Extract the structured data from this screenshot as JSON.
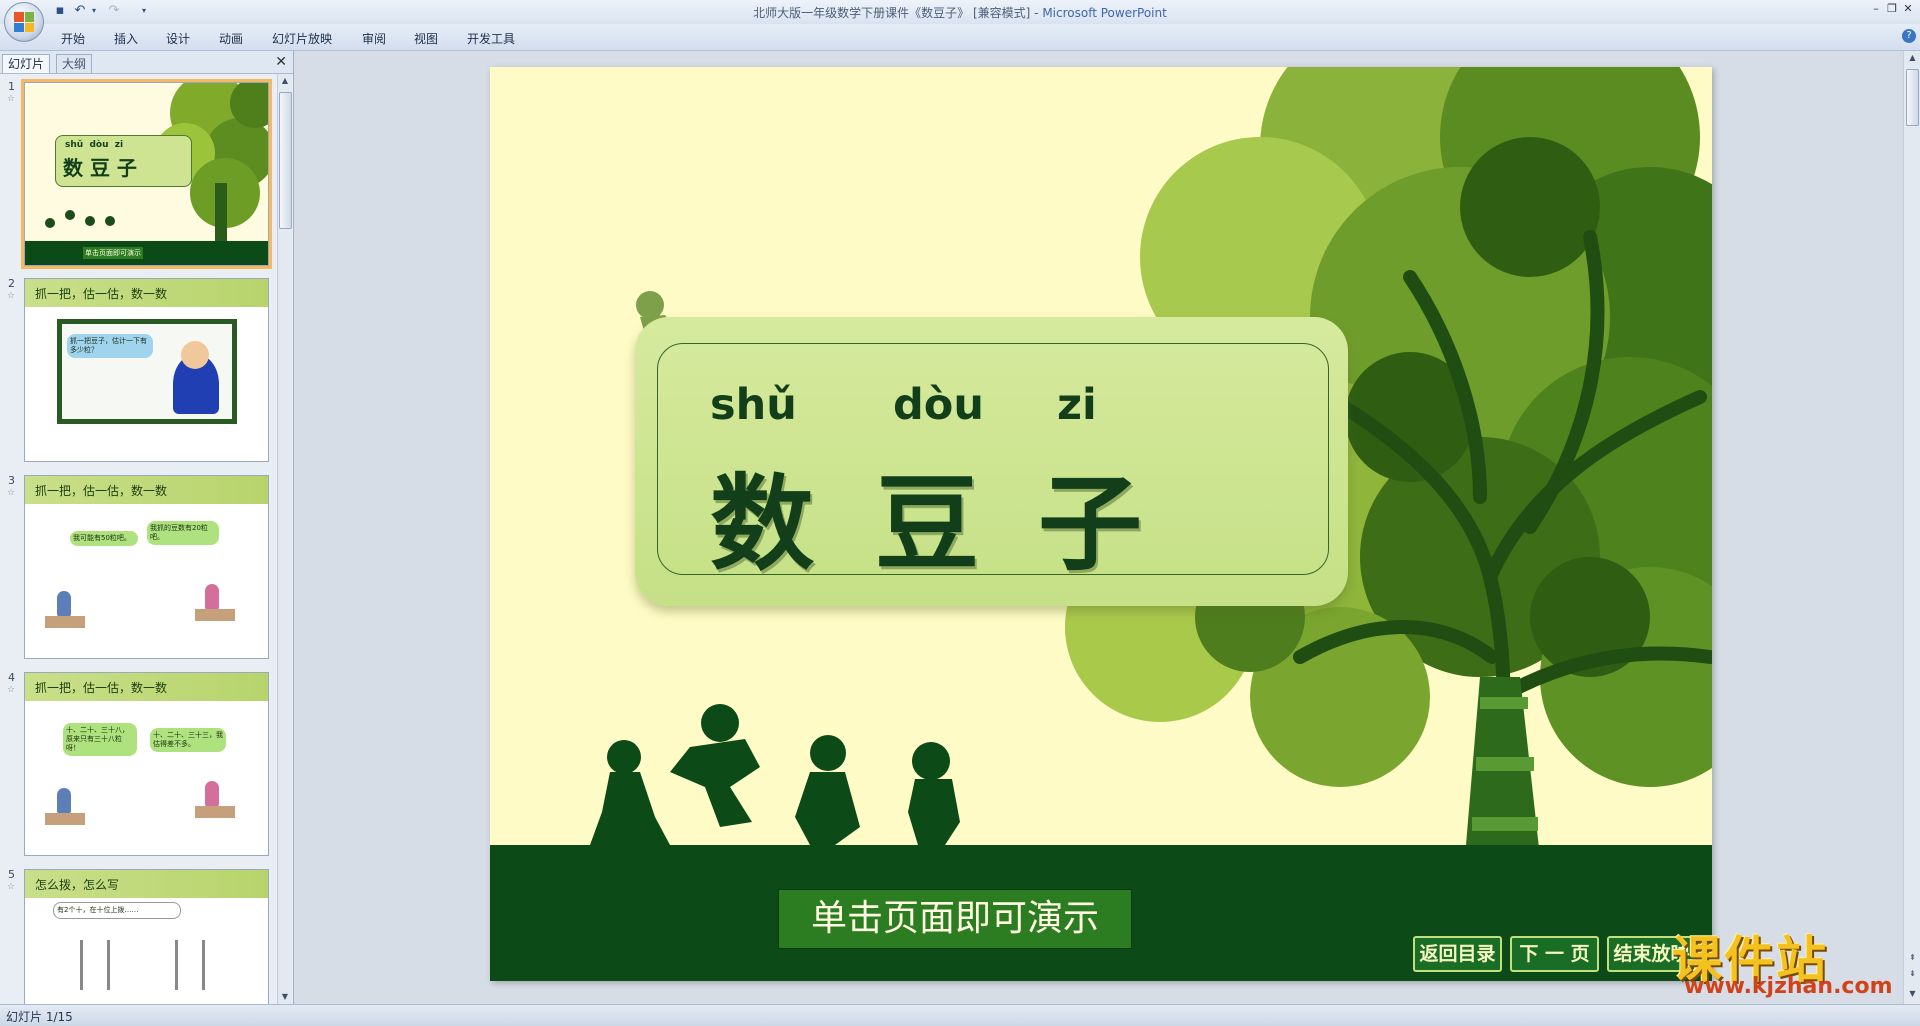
{
  "window": {
    "title": "北师大版一年级数学下册课件《数豆子》 [兼容模式] - ",
    "app": "Microsoft PowerPoint"
  },
  "ribbon": {
    "tabs": [
      "开始",
      "插入",
      "设计",
      "动画",
      "幻灯片放映",
      "审阅",
      "视图",
      "开发工具"
    ]
  },
  "pane": {
    "tabs": [
      "幻灯片",
      "大纲"
    ],
    "thumbnails": [
      {
        "number": "1",
        "pinyin": "shǔ  dòu  zi",
        "title": "数 豆 子",
        "button": "单击页面即可演示"
      },
      {
        "number": "2",
        "title": "抓一把，估一估，数一数",
        "bubble": "抓一把豆子，估计一下有多少粒？"
      },
      {
        "number": "3",
        "title": "抓一把，估一估，数一数",
        "bubble_left": "我可能有50粒吧。",
        "bubble_right": "我抓的豆数有20粒吧。"
      },
      {
        "number": "4",
        "title": "抓一把，估一估，数一数",
        "bubble_left": "十、二十、三十八，原来只有三十八粒呀！",
        "bubble_right": "十、二十、三十三，我估得差不多。"
      },
      {
        "number": "5",
        "title": "怎么拨，怎么写",
        "bubble": "有2个十，在十位上拨……"
      }
    ]
  },
  "slide": {
    "pinyin": [
      "shǔ",
      "dòu",
      "zi"
    ],
    "characters": [
      "数",
      "豆",
      "子"
    ],
    "start_button": "单击页面即可演示",
    "nav": [
      "返回目录",
      "下 一 页",
      "结束放映"
    ]
  },
  "watermark": {
    "site_name": "课件站",
    "url": "www.kjzhan.com"
  },
  "status": {
    "text": "幻灯片 1/15"
  }
}
